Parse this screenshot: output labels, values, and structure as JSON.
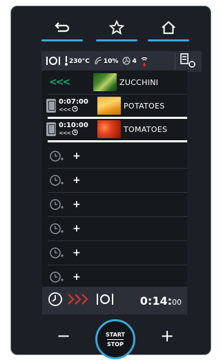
{
  "status": {
    "temperature": "230°C",
    "humidity": "10%",
    "fan_speed": "4"
  },
  "rows": [
    {
      "food": "ZUCCHINI",
      "time": "",
      "active": false
    },
    {
      "food": "POTATOES",
      "time": "0:07:00",
      "active": true
    },
    {
      "food": "TOMATOES",
      "time": "0:10:00",
      "active": true
    }
  ],
  "empty_slot_label": "+",
  "footer": {
    "total_time_main": "0:14:",
    "total_time_small": "00"
  },
  "controls": {
    "minus_label": "−",
    "plus_label": "+",
    "start_label": "START",
    "stop_label": "STOP"
  },
  "colors": {
    "accent": "#3aa8d8",
    "chevron_green": "#1aa870",
    "chevron_red": "#d0322c"
  },
  "icons": [
    "back-icon",
    "star-icon",
    "home-icon",
    "tray-icon",
    "clock-icon",
    "wifi-icon",
    "fan-icon",
    "humidity-icon",
    "thermometer-icon"
  ]
}
